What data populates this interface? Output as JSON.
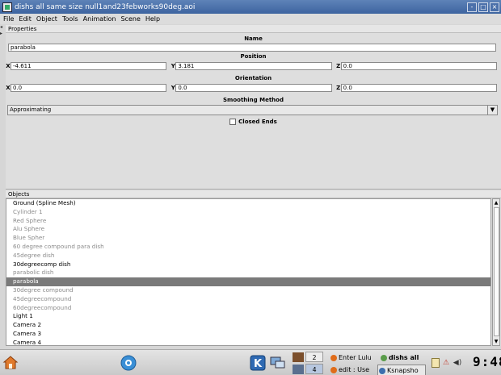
{
  "window": {
    "title": "dishs all same size null1and23febworks90deg.aoi",
    "controls": [
      "-",
      "□",
      "×"
    ]
  },
  "menu": [
    "File",
    "Edit",
    "Object",
    "Tools",
    "Animation",
    "Scene",
    "Help"
  ],
  "properties": {
    "header": "Properties",
    "name_label": "Name",
    "name_value": "parabola",
    "position_label": "Position",
    "position": {
      "x": "-4.611",
      "y": "3.181",
      "z": "0.0"
    },
    "orientation_label": "Orientation",
    "orientation": {
      "x": "0.0",
      "y": "0.0",
      "z": "0.0"
    },
    "axis_labels": {
      "x": "X",
      "y": "Y",
      "z": "Z"
    },
    "smoothing_label": "Smoothing Method",
    "smoothing_value": "Approximating",
    "closed_ends_label": "Closed Ends"
  },
  "objects": {
    "header": "Objects",
    "items": [
      {
        "label": "Ground (Spline Mesh)",
        "state": "normal"
      },
      {
        "label": "Cylinder 1",
        "state": "dim"
      },
      {
        "label": "Red Sphere",
        "state": "dim"
      },
      {
        "label": "Alu Sphere",
        "state": "dim"
      },
      {
        "label": "Blue Spher",
        "state": "dim"
      },
      {
        "label": " 60 degree compound para dish",
        "state": "dim"
      },
      {
        "label": "45degree dish",
        "state": "dim"
      },
      {
        "label": "30degreecomp dish",
        "state": "normal"
      },
      {
        "label": "parabolic dish",
        "state": "dim"
      },
      {
        "label": "parabola",
        "state": "selected"
      },
      {
        "label": "30degree compound",
        "state": "dim"
      },
      {
        "label": "45degreecompound",
        "state": "dim"
      },
      {
        "label": "60degreecompound",
        "state": "dim"
      },
      {
        "label": "Light 1",
        "state": "normal"
      },
      {
        "label": "Camera 2",
        "state": "normal"
      },
      {
        "label": "Camera 3",
        "state": "normal"
      },
      {
        "label": "Camera 4",
        "state": "normal"
      }
    ]
  },
  "taskbar": {
    "pager": [
      "2",
      "4"
    ],
    "tasks": [
      {
        "label": "Enter Lulu",
        "icon": "firefox-icon"
      },
      {
        "label": "dishs all",
        "icon": "aoi-icon"
      },
      {
        "label": "edit : Use",
        "icon": "firefox-icon"
      },
      {
        "label": "Ksnapsho",
        "icon": "ksnapshot-icon"
      }
    ],
    "clock": "9:48"
  },
  "colors": {
    "titlebar": "#4a70aa",
    "selection": "#7a7a7a"
  }
}
